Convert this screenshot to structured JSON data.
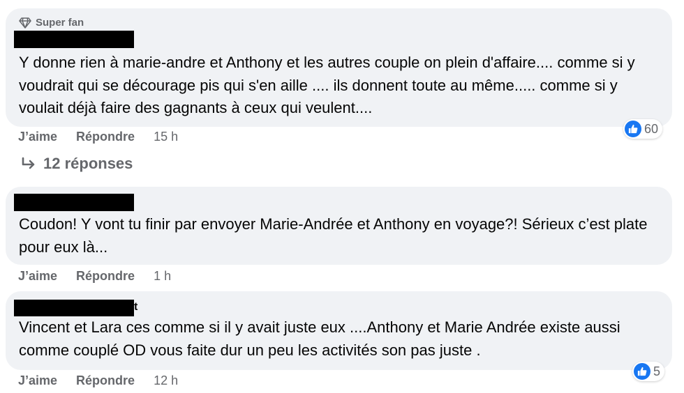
{
  "comments": [
    {
      "badge": "Super fan",
      "text": "Y donne rien à marie-andre et Anthony et les autres couple on plein d'affaire.... comme si y voudrait qui se décourage pis qui s'en aille .... ils donnent toute au même..... comme si y voulait déjà faire des gagnants à ceux qui veulent....",
      "like_label": "J’aime",
      "reply_label": "Répondre",
      "time": "15 h",
      "reaction_count": "60"
    },
    {
      "text": "Coudon! Y vont tu finir par envoyer Marie-Andrée et Anthony en voyage?! Sérieux c’est plate pour eux là...",
      "like_label": "J’aime",
      "reply_label": "Répondre",
      "time": "1 h"
    },
    {
      "name_tail": "t",
      "text": "Vincent et Lara ces comme si il y avait juste eux ....Anthony et Marie Andrée existe aussi comme couplé OD vous faite dur un peu les activités son pas juste .",
      "like_label": "J’aime",
      "reply_label": "Répondre",
      "time": "12 h",
      "reaction_count": "5"
    }
  ],
  "replies_link": "12 réponses",
  "colors": {
    "bubble": "#f0f2f5",
    "secondary_text": "#65676b",
    "like_blue": "#1877f2"
  },
  "icons": {
    "badge": "diamond-icon",
    "reaction": "thumbs-up-icon",
    "replies": "reply-arrow-icon"
  }
}
